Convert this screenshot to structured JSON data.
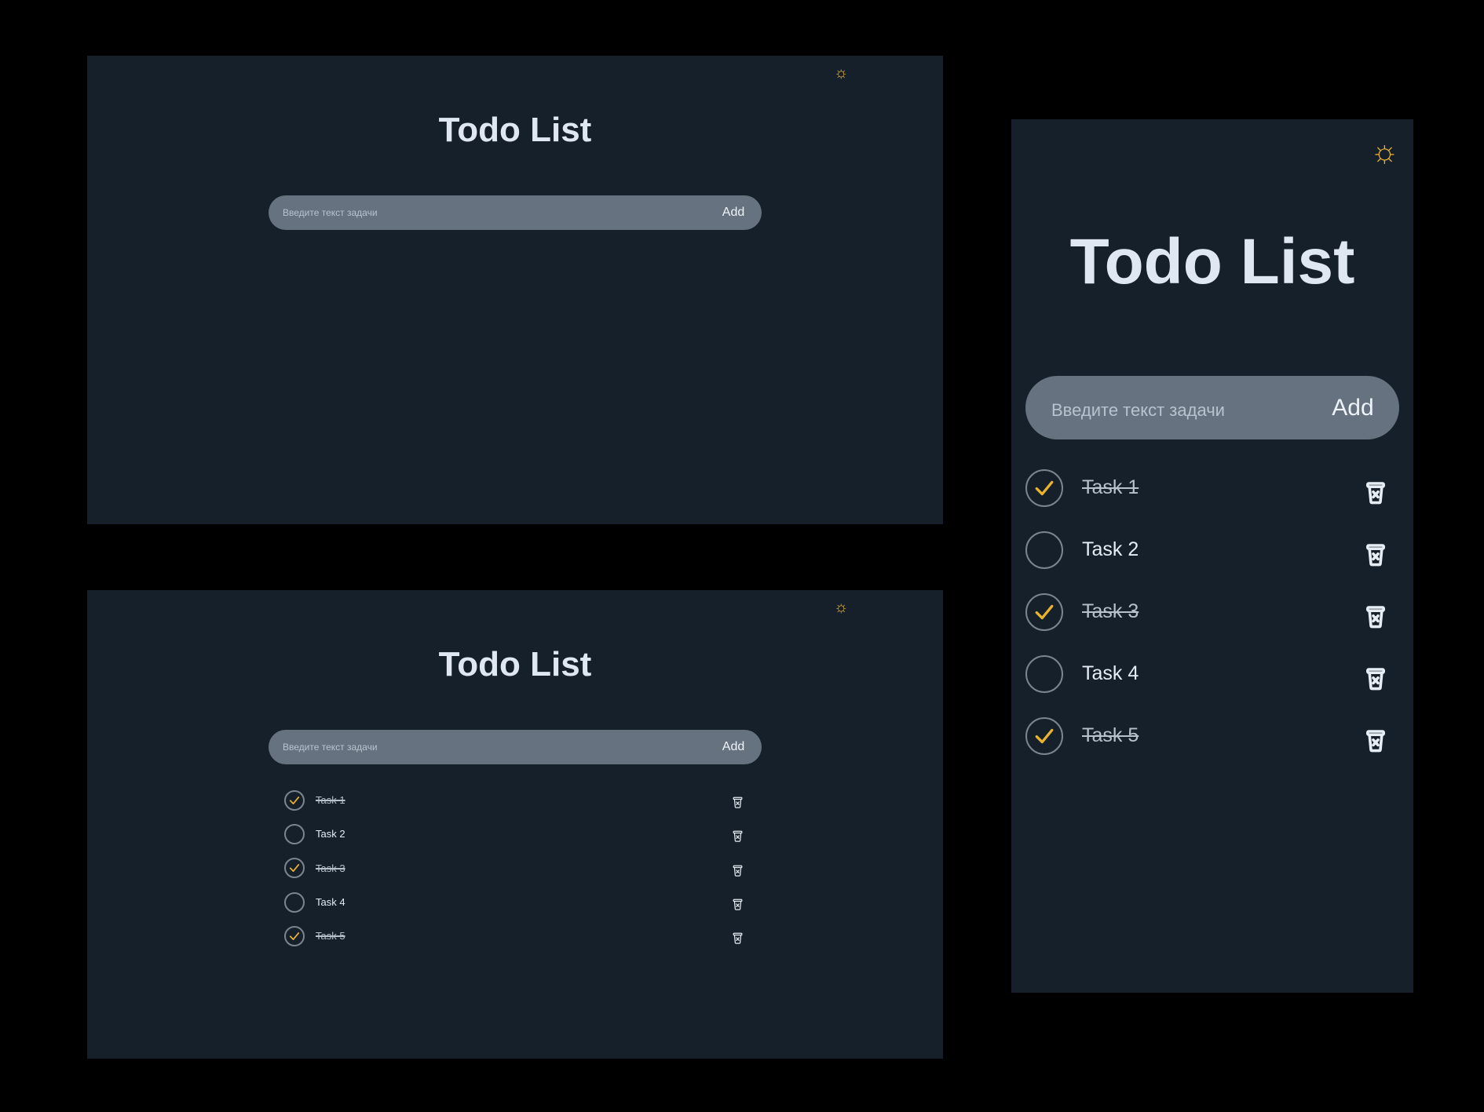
{
  "app": {
    "title": "Todo List",
    "input_placeholder": "Введите текст задачи",
    "add_label": "Add",
    "theme_icon": "sun-icon",
    "accent_color": "#e9b330",
    "background_color": "#16202a"
  },
  "tasks": [
    {
      "label": "Task 1",
      "done": true
    },
    {
      "label": "Task 2",
      "done": false
    },
    {
      "label": "Task 3",
      "done": true
    },
    {
      "label": "Task 4",
      "done": false
    },
    {
      "label": "Task 5",
      "done": true
    }
  ],
  "screens": [
    {
      "name": "desktop-empty",
      "show_tasks": false
    },
    {
      "name": "desktop-with-tasks",
      "show_tasks": true
    },
    {
      "name": "mobile-with-tasks",
      "show_tasks": true
    }
  ]
}
